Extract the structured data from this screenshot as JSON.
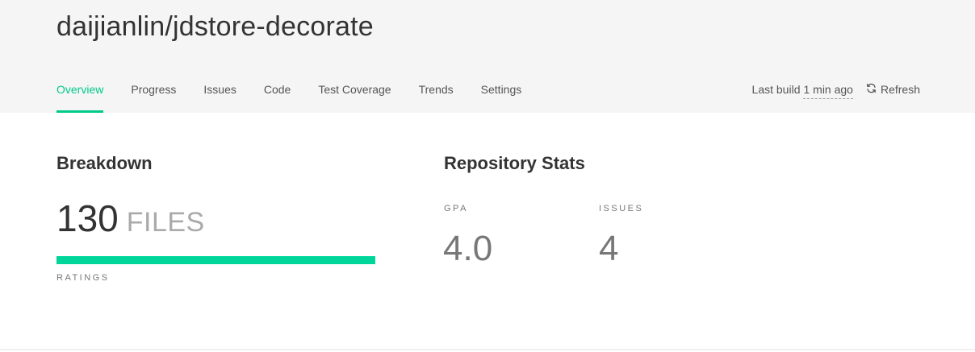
{
  "header": {
    "repo_title": "daijianlin/jdstore-decorate",
    "tabs": [
      {
        "label": "Overview",
        "active": true
      },
      {
        "label": "Progress",
        "active": false
      },
      {
        "label": "Issues",
        "active": false
      },
      {
        "label": "Code",
        "active": false
      },
      {
        "label": "Test Coverage",
        "active": false
      },
      {
        "label": "Trends",
        "active": false
      },
      {
        "label": "Settings",
        "active": false
      }
    ],
    "build": {
      "prefix": "Last build",
      "time": "1 min ago",
      "refresh_label": "Refresh",
      "refresh_icon": "refresh-icon"
    }
  },
  "breakdown": {
    "title": "Breakdown",
    "file_count": "130",
    "file_unit": "FILES",
    "ratings_label": "RATINGS",
    "ratings_fill_fraction": 1.0
  },
  "stats": {
    "title": "Repository Stats",
    "gpa_label": "GPA",
    "gpa_value": "4.0",
    "issues_label": "ISSUES",
    "issues_value": "4"
  },
  "colors": {
    "accent": "#00c98a",
    "bar": "#00d69a",
    "header_bg": "#f5f5f5"
  }
}
